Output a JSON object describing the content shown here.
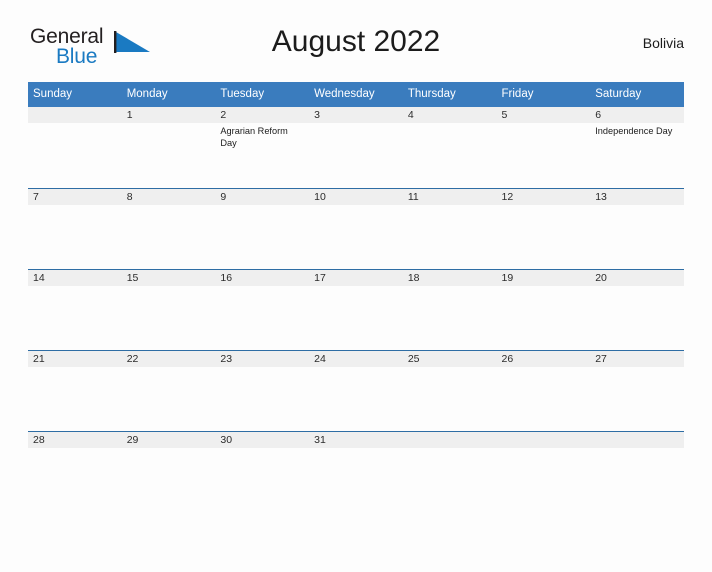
{
  "brand": {
    "name_part1": "General",
    "name_part2": "Blue",
    "flag_icon": "blue-flag-triangle",
    "accent_color": "#1a7ac2"
  },
  "header": {
    "title": "August 2022",
    "region": "Bolivia"
  },
  "theme": {
    "header_blue": "#3a7cbe",
    "rule_blue": "#2e6da4",
    "band_gray": "#efefef",
    "page_background": "#fdfdfd"
  },
  "calendar": {
    "month": "August",
    "year": "2022",
    "weekday_headers": [
      "Sunday",
      "Monday",
      "Tuesday",
      "Wednesday",
      "Thursday",
      "Friday",
      "Saturday"
    ],
    "weeks": [
      [
        {
          "day": "",
          "event": ""
        },
        {
          "day": "1",
          "event": ""
        },
        {
          "day": "2",
          "event": "Agrarian Reform Day"
        },
        {
          "day": "3",
          "event": ""
        },
        {
          "day": "4",
          "event": ""
        },
        {
          "day": "5",
          "event": ""
        },
        {
          "day": "6",
          "event": "Independence Day"
        }
      ],
      [
        {
          "day": "7",
          "event": ""
        },
        {
          "day": "8",
          "event": ""
        },
        {
          "day": "9",
          "event": ""
        },
        {
          "day": "10",
          "event": ""
        },
        {
          "day": "11",
          "event": ""
        },
        {
          "day": "12",
          "event": ""
        },
        {
          "day": "13",
          "event": ""
        }
      ],
      [
        {
          "day": "14",
          "event": ""
        },
        {
          "day": "15",
          "event": ""
        },
        {
          "day": "16",
          "event": ""
        },
        {
          "day": "17",
          "event": ""
        },
        {
          "day": "18",
          "event": ""
        },
        {
          "day": "19",
          "event": ""
        },
        {
          "day": "20",
          "event": ""
        }
      ],
      [
        {
          "day": "21",
          "event": ""
        },
        {
          "day": "22",
          "event": ""
        },
        {
          "day": "23",
          "event": ""
        },
        {
          "day": "24",
          "event": ""
        },
        {
          "day": "25",
          "event": ""
        },
        {
          "day": "26",
          "event": ""
        },
        {
          "day": "27",
          "event": ""
        }
      ],
      [
        {
          "day": "28",
          "event": ""
        },
        {
          "day": "29",
          "event": ""
        },
        {
          "day": "30",
          "event": ""
        },
        {
          "day": "31",
          "event": ""
        },
        {
          "day": "",
          "event": ""
        },
        {
          "day": "",
          "event": ""
        },
        {
          "day": "",
          "event": ""
        }
      ]
    ]
  }
}
